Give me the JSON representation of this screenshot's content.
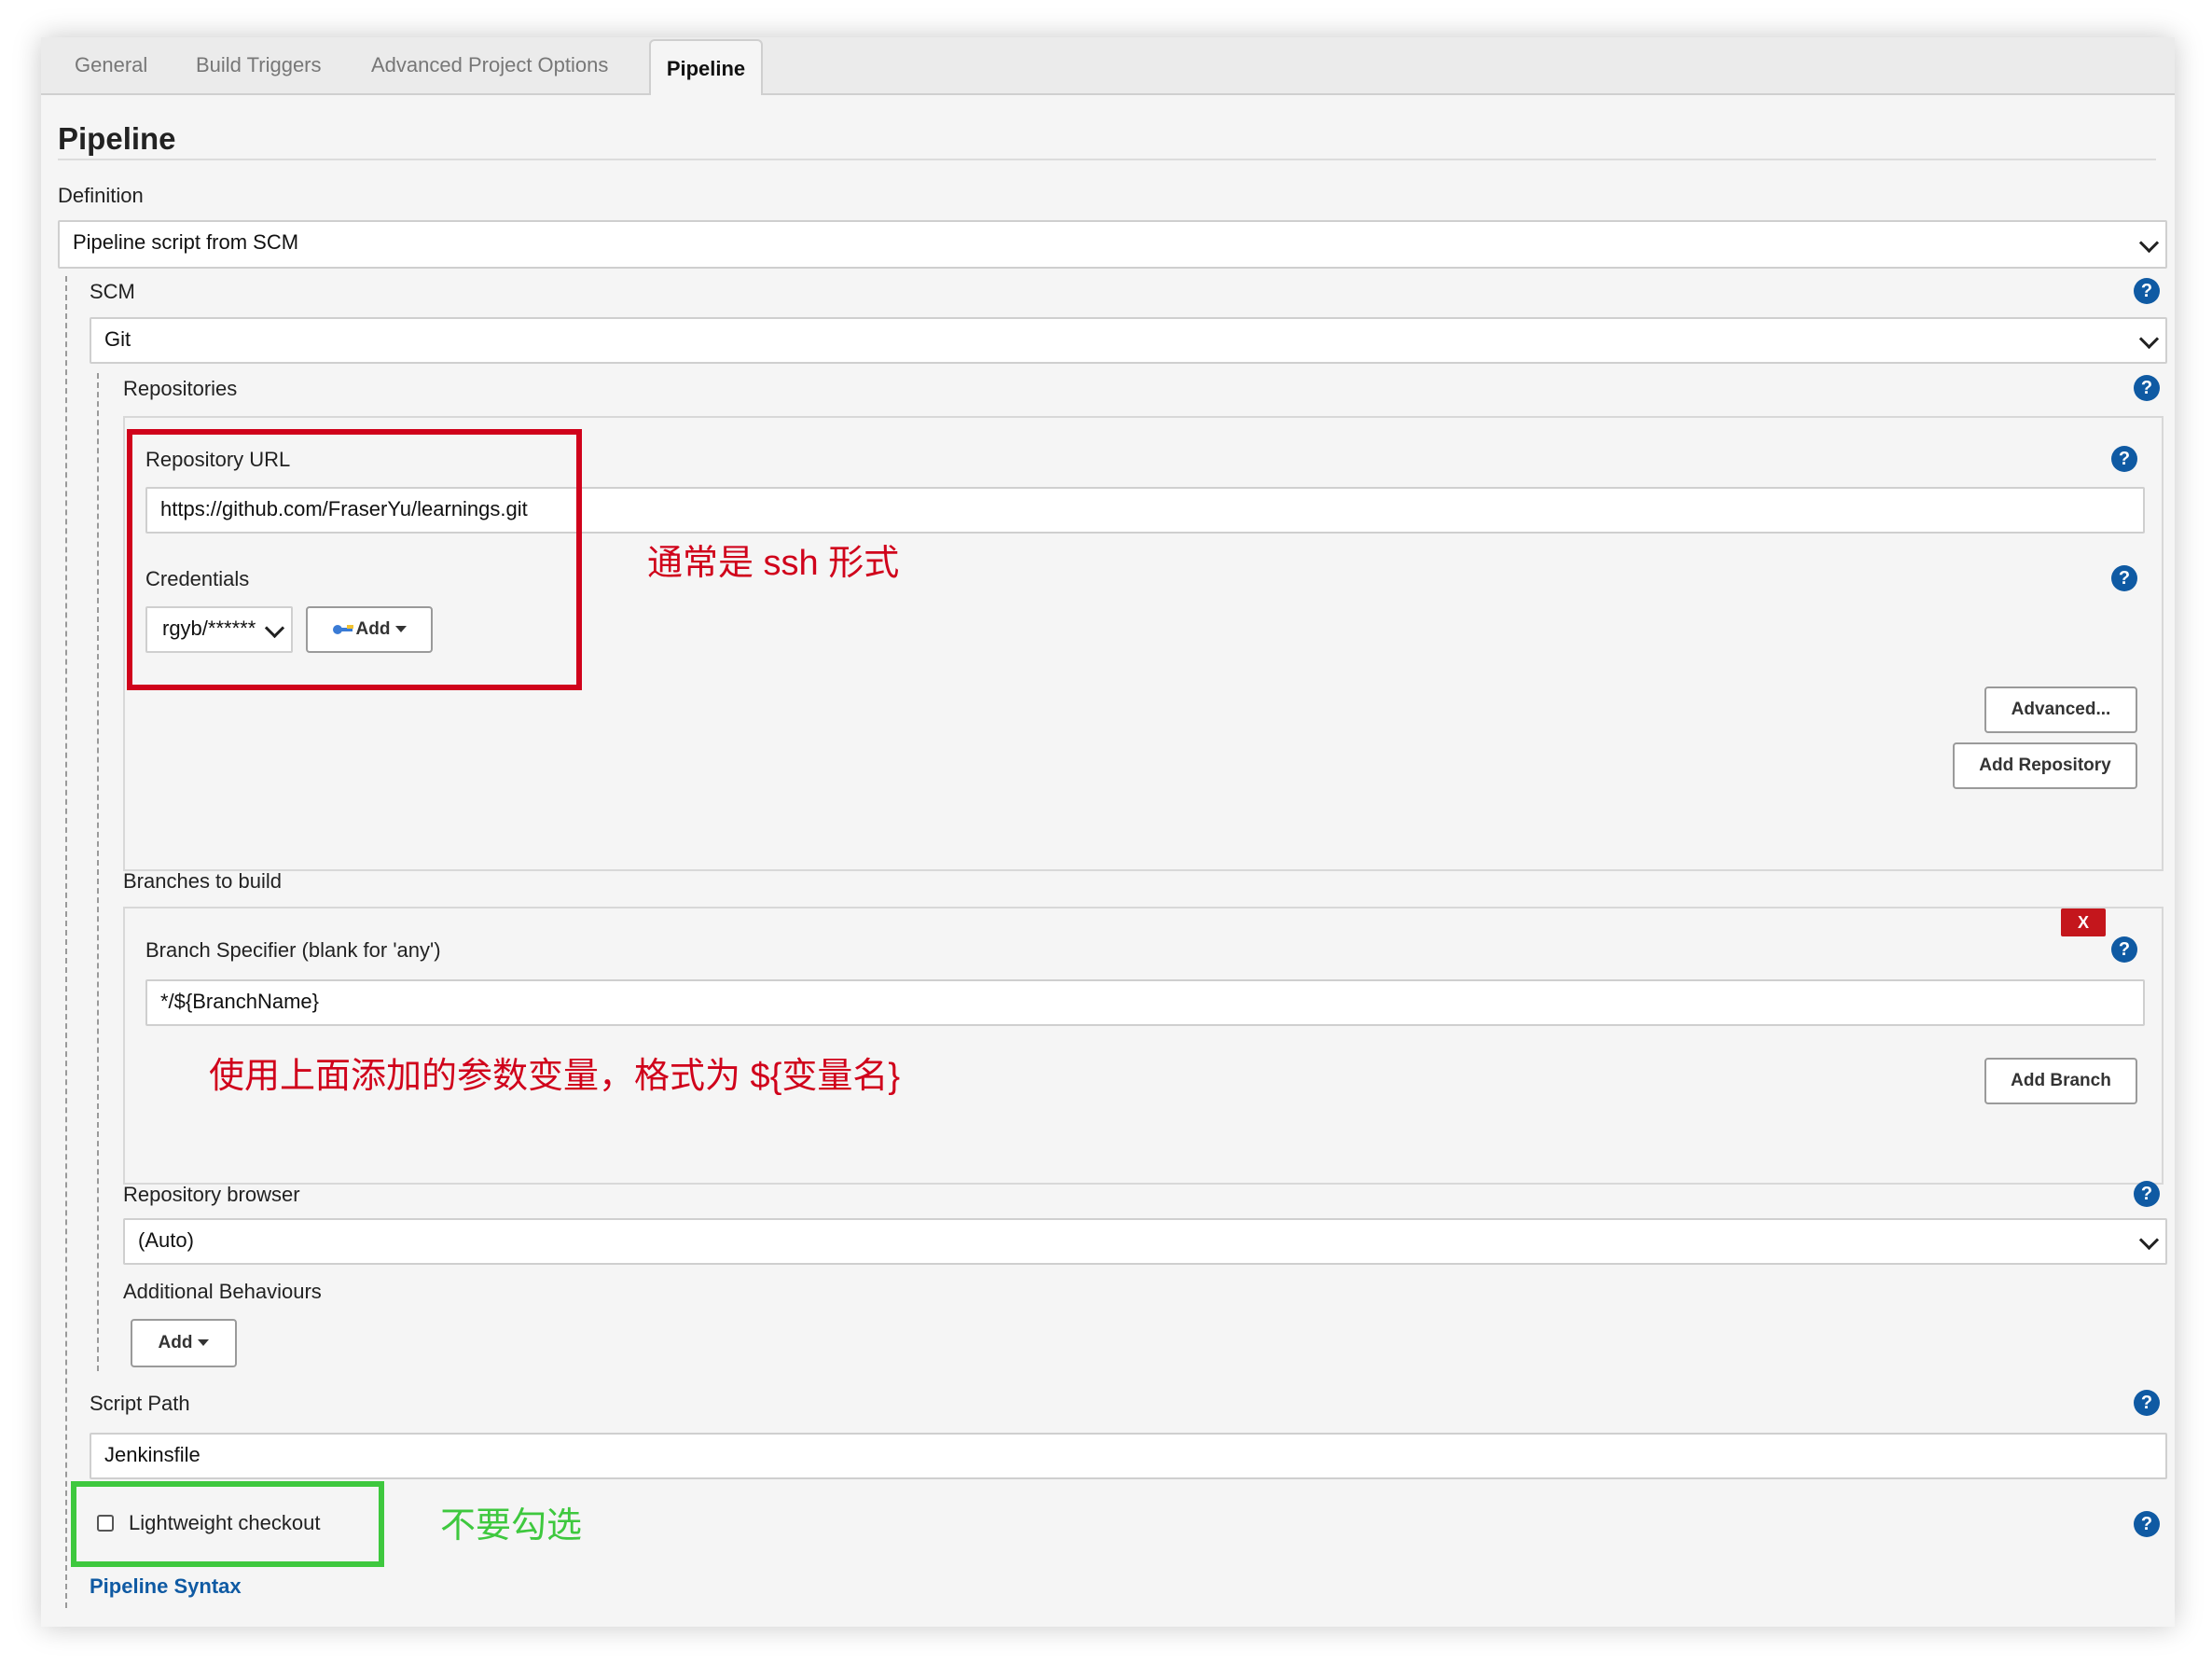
{
  "tabs": [
    {
      "label": "General",
      "active": false
    },
    {
      "label": "Build Triggers",
      "active": false
    },
    {
      "label": "Advanced Project Options",
      "active": false
    },
    {
      "label": "Pipeline",
      "active": true
    }
  ],
  "section_title": "Pipeline",
  "definition": {
    "label": "Definition",
    "value": "Pipeline script from SCM"
  },
  "scm": {
    "label": "SCM",
    "value": "Git"
  },
  "repositories": {
    "label": "Repositories",
    "url_label": "Repository URL",
    "url_value": "https://github.com/FraserYu/learnings.git",
    "credentials_label": "Credentials",
    "credentials_value": "rgyb/******",
    "add_label": "Add",
    "advanced_label": "Advanced...",
    "add_repository_label": "Add Repository"
  },
  "branches": {
    "label": "Branches to build",
    "specifier_label": "Branch Specifier (blank for 'any')",
    "specifier_value": "*/${BranchName}",
    "delete_label": "X",
    "add_branch_label": "Add Branch"
  },
  "repository_browser": {
    "label": "Repository browser",
    "value": "(Auto)"
  },
  "additional_behaviours": {
    "label": "Additional Behaviours",
    "add_label": "Add"
  },
  "script_path": {
    "label": "Script Path",
    "value": "Jenkinsfile"
  },
  "lightweight": {
    "label": "Lightweight checkout",
    "checked": false
  },
  "pipeline_syntax_link": "Pipeline Syntax",
  "annotations": {
    "url_note": "通常是 ssh 形式",
    "branch_note": "使用上面添加的参数变量，格式为 ${变量名}",
    "checkout_note": "不要勾选",
    "red_color": "#d0021b",
    "green_color": "#3ec83e"
  },
  "help_glyph": "?"
}
